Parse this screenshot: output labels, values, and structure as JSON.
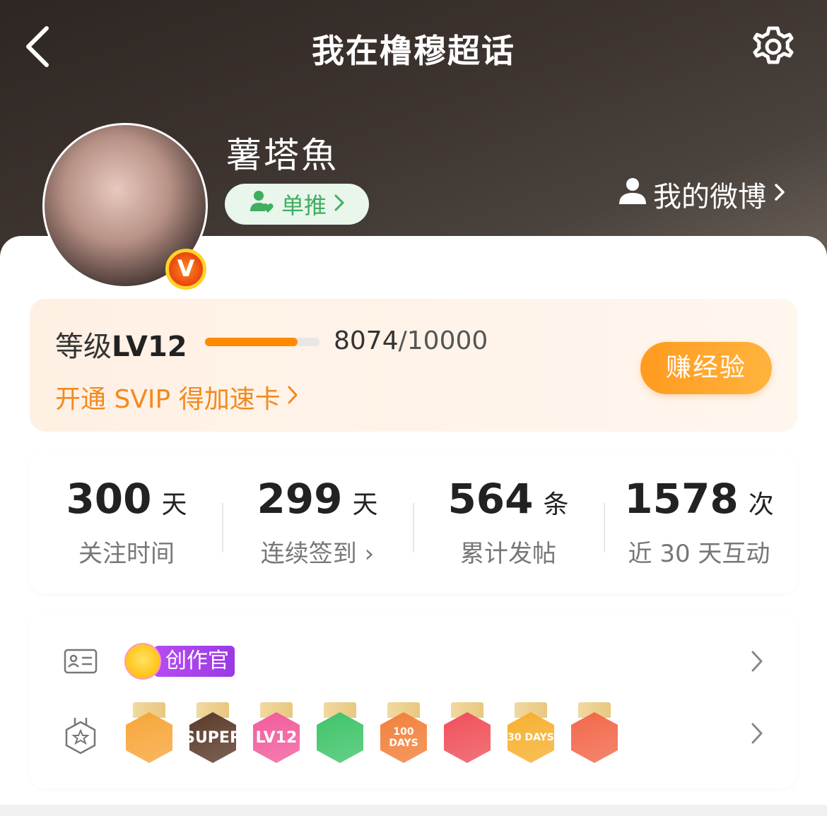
{
  "nav": {
    "title": "我在橹穆超话"
  },
  "profile": {
    "name": "薯塔魚",
    "verified_mark": "V",
    "fan_tag": "单推",
    "my_weibo": "我的微博"
  },
  "level": {
    "prefix": "等级",
    "level": "LV12",
    "current": "8074",
    "total": "/10000",
    "progress": 0.8074,
    "svip_link": "开通 SVIP 得加速卡",
    "earn_button": "赚经验"
  },
  "stats": [
    {
      "value": "300",
      "unit": "天",
      "label": "关注时间"
    },
    {
      "value": "299",
      "unit": "天",
      "label": "连续签到 ›"
    },
    {
      "value": "564",
      "unit": "条",
      "label": "累计发帖"
    },
    {
      "value": "1578",
      "unit": "次",
      "label": "近 30 天互动"
    }
  ],
  "identity": {
    "creator_label": "创作官"
  },
  "medals": [
    {
      "name": "crown",
      "text": "",
      "color": "#f7a63a"
    },
    {
      "name": "super",
      "text": "SUPER",
      "color": "#5b3b2a"
    },
    {
      "name": "lv12",
      "text": "LV12",
      "color": "#f25c9c"
    },
    {
      "name": "hand",
      "text": "",
      "color": "#3fc46a"
    },
    {
      "name": "100-days",
      "text": "100 DAYS",
      "color": "#f2803b"
    },
    {
      "name": "trophy",
      "text": "",
      "color": "#f0505a"
    },
    {
      "name": "30-days",
      "text": "30 DAYS",
      "color": "#f6b030"
    },
    {
      "name": "rock-hand",
      "text": "",
      "color": "#f2684a"
    }
  ],
  "colors": {
    "accent": "#ff8a00",
    "svip": "#f28a1e",
    "fan_tag_text": "#3fae5f",
    "creator_purple": "#a542ea"
  }
}
